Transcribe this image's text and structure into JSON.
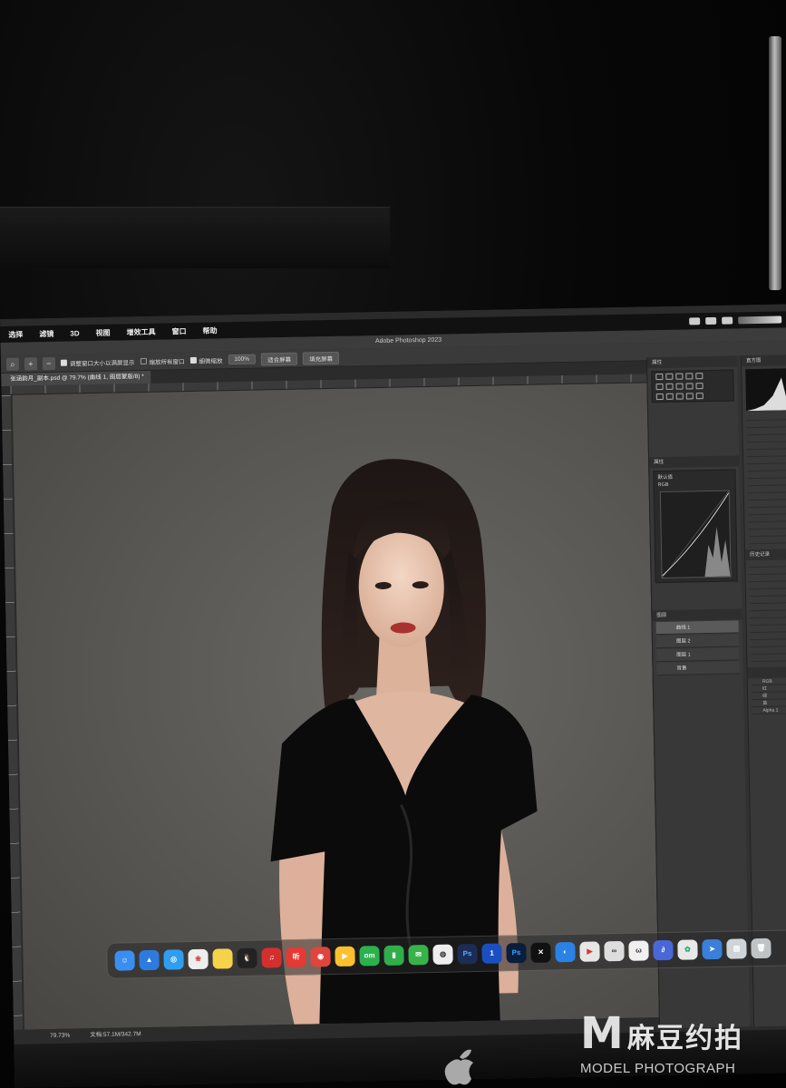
{
  "menubar": {
    "items": [
      "选择",
      "滤镜",
      "3D",
      "视图",
      "增效工具",
      "窗口",
      "帮助"
    ]
  },
  "photoshop": {
    "title": "Adobe Photoshop 2023",
    "options": {
      "resize_windows_label": "调整窗口大小以满屏显示",
      "zoom_all_label": "缩放所有窗口",
      "scrubby_zoom_label": "细微缩放",
      "zoom_value": "100%",
      "fit_screen_label": "适合屏幕",
      "fill_screen_label": "填充屏幕"
    },
    "document_tab": "张涵韵月_副本.psd @ 79.7% (曲线 1, 图层蒙版/8) *",
    "status_zoom": "79.73%",
    "status_doc": "文档:57.1M/342.7M",
    "panels": {
      "properties_tab": "属性",
      "curves_preset": "默认值",
      "channel": "RGB",
      "layers_tab": "图层",
      "layer_curves": "曲线 1",
      "layer_2": "图层 2",
      "layer_1": "图层 1",
      "layer_bg": "背景",
      "channels": [
        "RGB",
        "红",
        "绿",
        "蓝",
        "Alpha 1"
      ],
      "history_tab": "历史记录",
      "histogram_tab": "直方图"
    }
  },
  "dock": {
    "apps": [
      "finder",
      "launchpad",
      "safari",
      "photos",
      "notes",
      "qq",
      "netease-music",
      "ting",
      "weibo",
      "video",
      "om",
      "numbers",
      "wechat",
      "chrome",
      "ps-beta",
      "1password",
      "photoshop",
      "capcut",
      "keynote",
      "pdf",
      "finder-2",
      "tencent-meeting",
      "siri",
      "settings",
      "system-prefs",
      "trash"
    ],
    "labels": {
      "om": "om",
      "ps": "Ps",
      "ps2": "Ps",
      "one": "1",
      "ting": "听"
    }
  },
  "watermark": {
    "logo_letter": "M",
    "chinese": "麻豆约拍",
    "english": "MODEL PHOTOGRAPH"
  }
}
